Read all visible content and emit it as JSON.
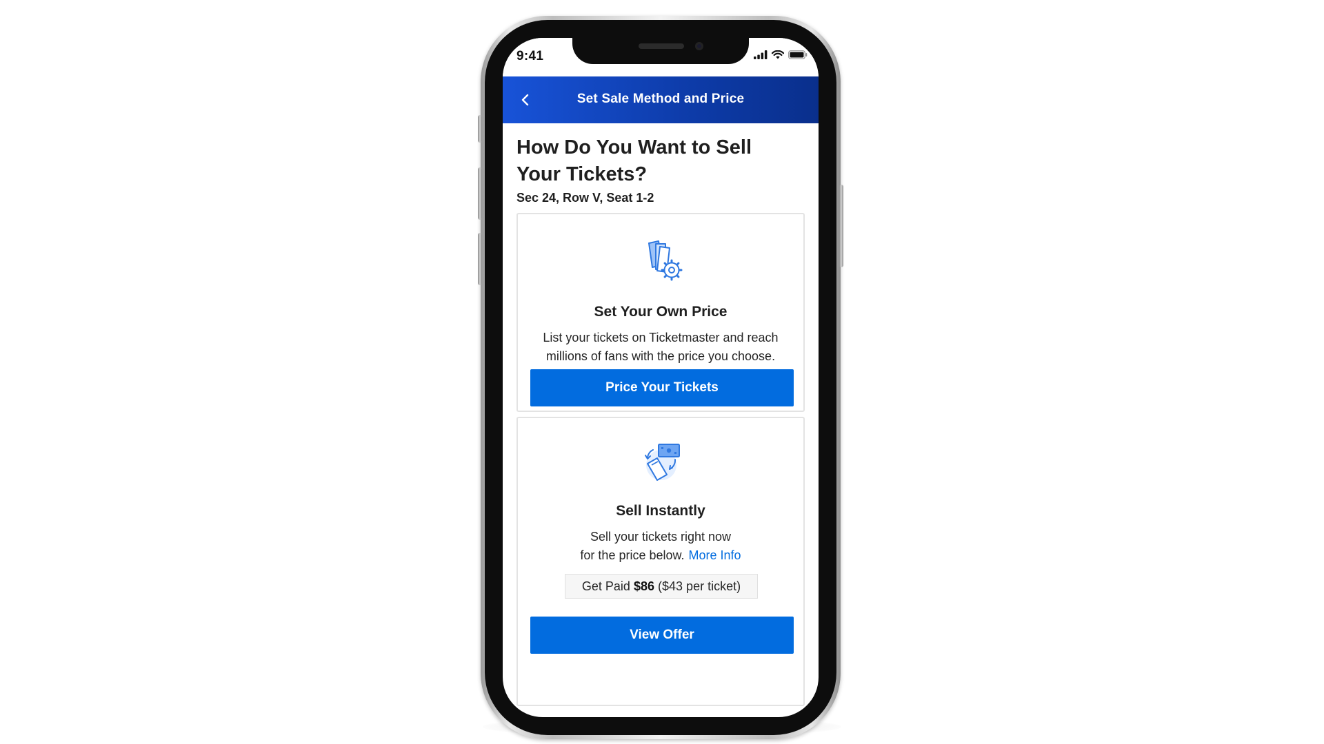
{
  "status_bar": {
    "time": "9:41",
    "icons": [
      "cellular-signal-icon",
      "wifi-icon",
      "battery-icon"
    ]
  },
  "header": {
    "back_icon": "chevron-left-icon",
    "title": "Set Sale Method and Price"
  },
  "page": {
    "title": "How Do You Want to Sell Your Tickets?",
    "seat_info": "Sec 24, Row V, Seat 1-2"
  },
  "options": [
    {
      "icon": "tickets-gear-icon",
      "title": "Set Your Own Price",
      "description": "List your tickets on Ticketmaster and reach millions of fans with the price you choose.",
      "button_label": "Price Your Tickets"
    },
    {
      "icon": "ticket-cash-exchange-icon",
      "title": "Sell Instantly",
      "description_line1": "Sell your tickets right now",
      "description_line2": "for the price below.",
      "link_label": "More Info",
      "payout_prefix": "Get Paid",
      "payout_amount": "$86",
      "payout_per_ticket": "($43 per ticket)",
      "button_label": "View Offer"
    }
  ],
  "colors": {
    "header_blue": "#1853d8",
    "button_blue": "#026cdf",
    "link_blue": "#026cdf",
    "icon_blue": "#4a8ef0"
  }
}
